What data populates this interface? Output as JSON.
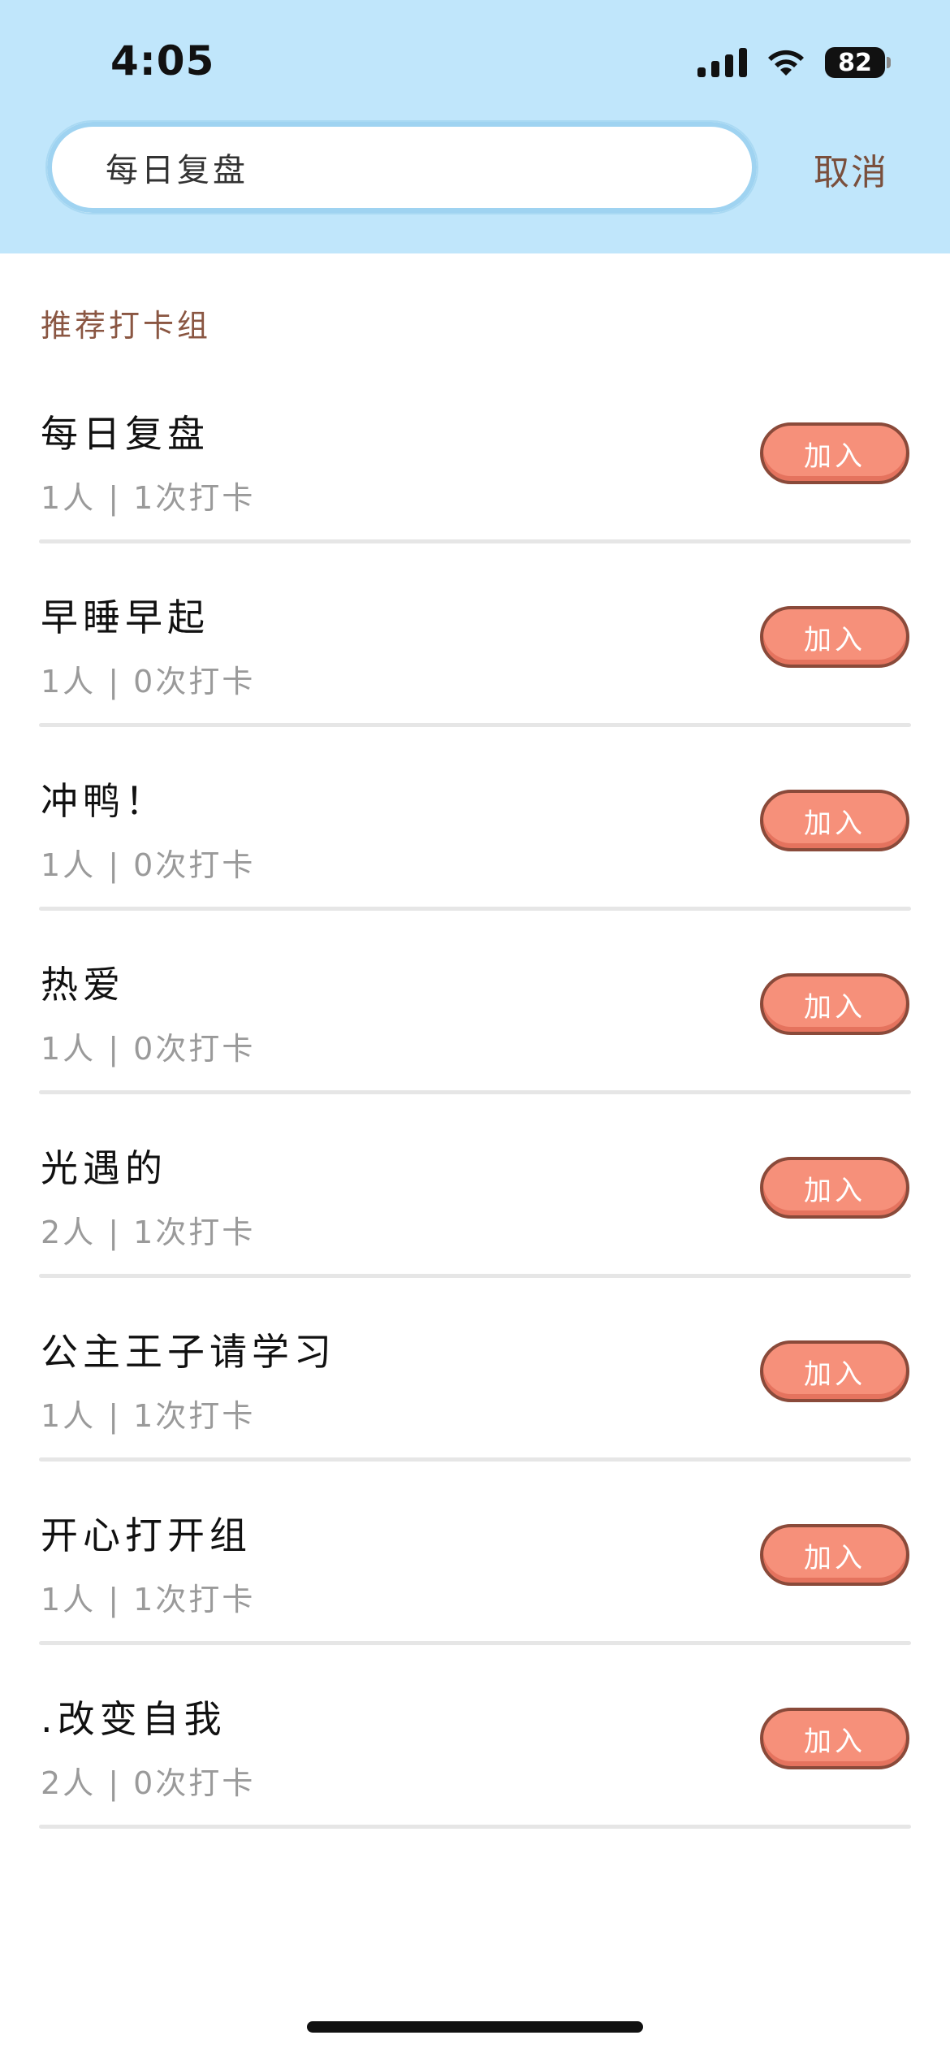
{
  "status_bar": {
    "time": "4:05",
    "battery": "82",
    "icons": [
      "signal-icon",
      "wifi-icon",
      "battery-icon"
    ]
  },
  "search": {
    "value": "每日复盘",
    "cancel_label": "取消"
  },
  "section": {
    "title": "推荐打卡组"
  },
  "groups": [
    {
      "name": "每日复盘",
      "meta": "1人 | 1次打卡",
      "button": "加入"
    },
    {
      "name": "早睡早起",
      "meta": "1人 | 0次打卡",
      "button": "加入"
    },
    {
      "name": "冲鸭！",
      "meta": "1人 | 0次打卡",
      "button": "加入"
    },
    {
      "name": "热爱",
      "meta": "1人 | 0次打卡",
      "button": "加入"
    },
    {
      "name": "光遇的",
      "meta": "2人 | 1次打卡",
      "button": "加入"
    },
    {
      "name": "公主王子请学习",
      "meta": "1人 | 1次打卡",
      "button": "加入"
    },
    {
      "name": "开心打开组",
      "meta": "1人 | 1次打卡",
      "button": "加入"
    },
    {
      "name": ".改变自我",
      "meta": "2人 | 0次打卡",
      "button": "加入"
    }
  ],
  "colors": {
    "header_bg": "#c0e6fb",
    "accent_brown": "#8a5642",
    "join_button": "#f6907a"
  }
}
